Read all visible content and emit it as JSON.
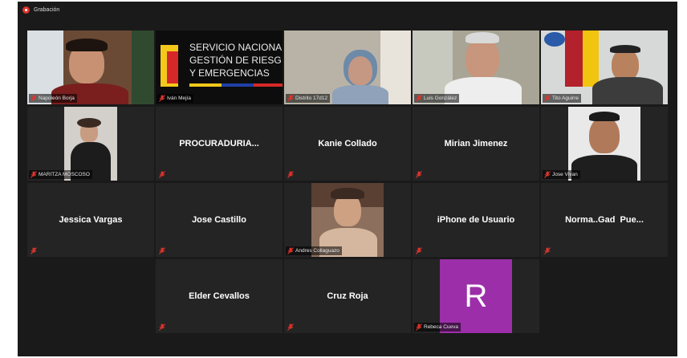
{
  "recording": {
    "label": "Grabación"
  },
  "participants": {
    "napoleon": {
      "name": "Napoleón Borja"
    },
    "ivan": {
      "name": "Iván Mejía",
      "logo_lines": [
        "SERVICIO NACIONA",
        "GESTIÓN DE RIESG",
        "Y EMERGENCIAS"
      ]
    },
    "distrito": {
      "name": "Distrito 17d12"
    },
    "luis": {
      "name": "Luis González"
    },
    "tito": {
      "name": "Tito Aguirre"
    },
    "maritza": {
      "name": "MARITZA MOSCOSO"
    },
    "procuraduria": {
      "name": "PROCURADURIA..."
    },
    "kanie": {
      "name": "Kanie Collado"
    },
    "mirian": {
      "name": "Mirian Jimenez"
    },
    "jose_vivian": {
      "name": "Jose Vivan"
    },
    "jessica": {
      "name": "Jessica Vargas"
    },
    "jose_castillo": {
      "name": "Jose Castillo"
    },
    "andres": {
      "name": "Andres Collaguazo"
    },
    "iphone": {
      "name": "iPhone de Usuario"
    },
    "norma": {
      "name": "Norma..Gad  Pue..."
    },
    "elder": {
      "name": "Elder Cevallos"
    },
    "cruz_roja": {
      "name": "Cruz Roja"
    },
    "rebeca": {
      "name": "Rebeca Cueva",
      "initial": "R"
    }
  },
  "colors": {
    "active_speaker": "#c6e32f",
    "muted_icon": "#e0342c",
    "avatar_bg": "#9c2fa9"
  },
  "icons": {
    "mic": "microphone-muted-icon",
    "record": "record-dot-icon"
  }
}
